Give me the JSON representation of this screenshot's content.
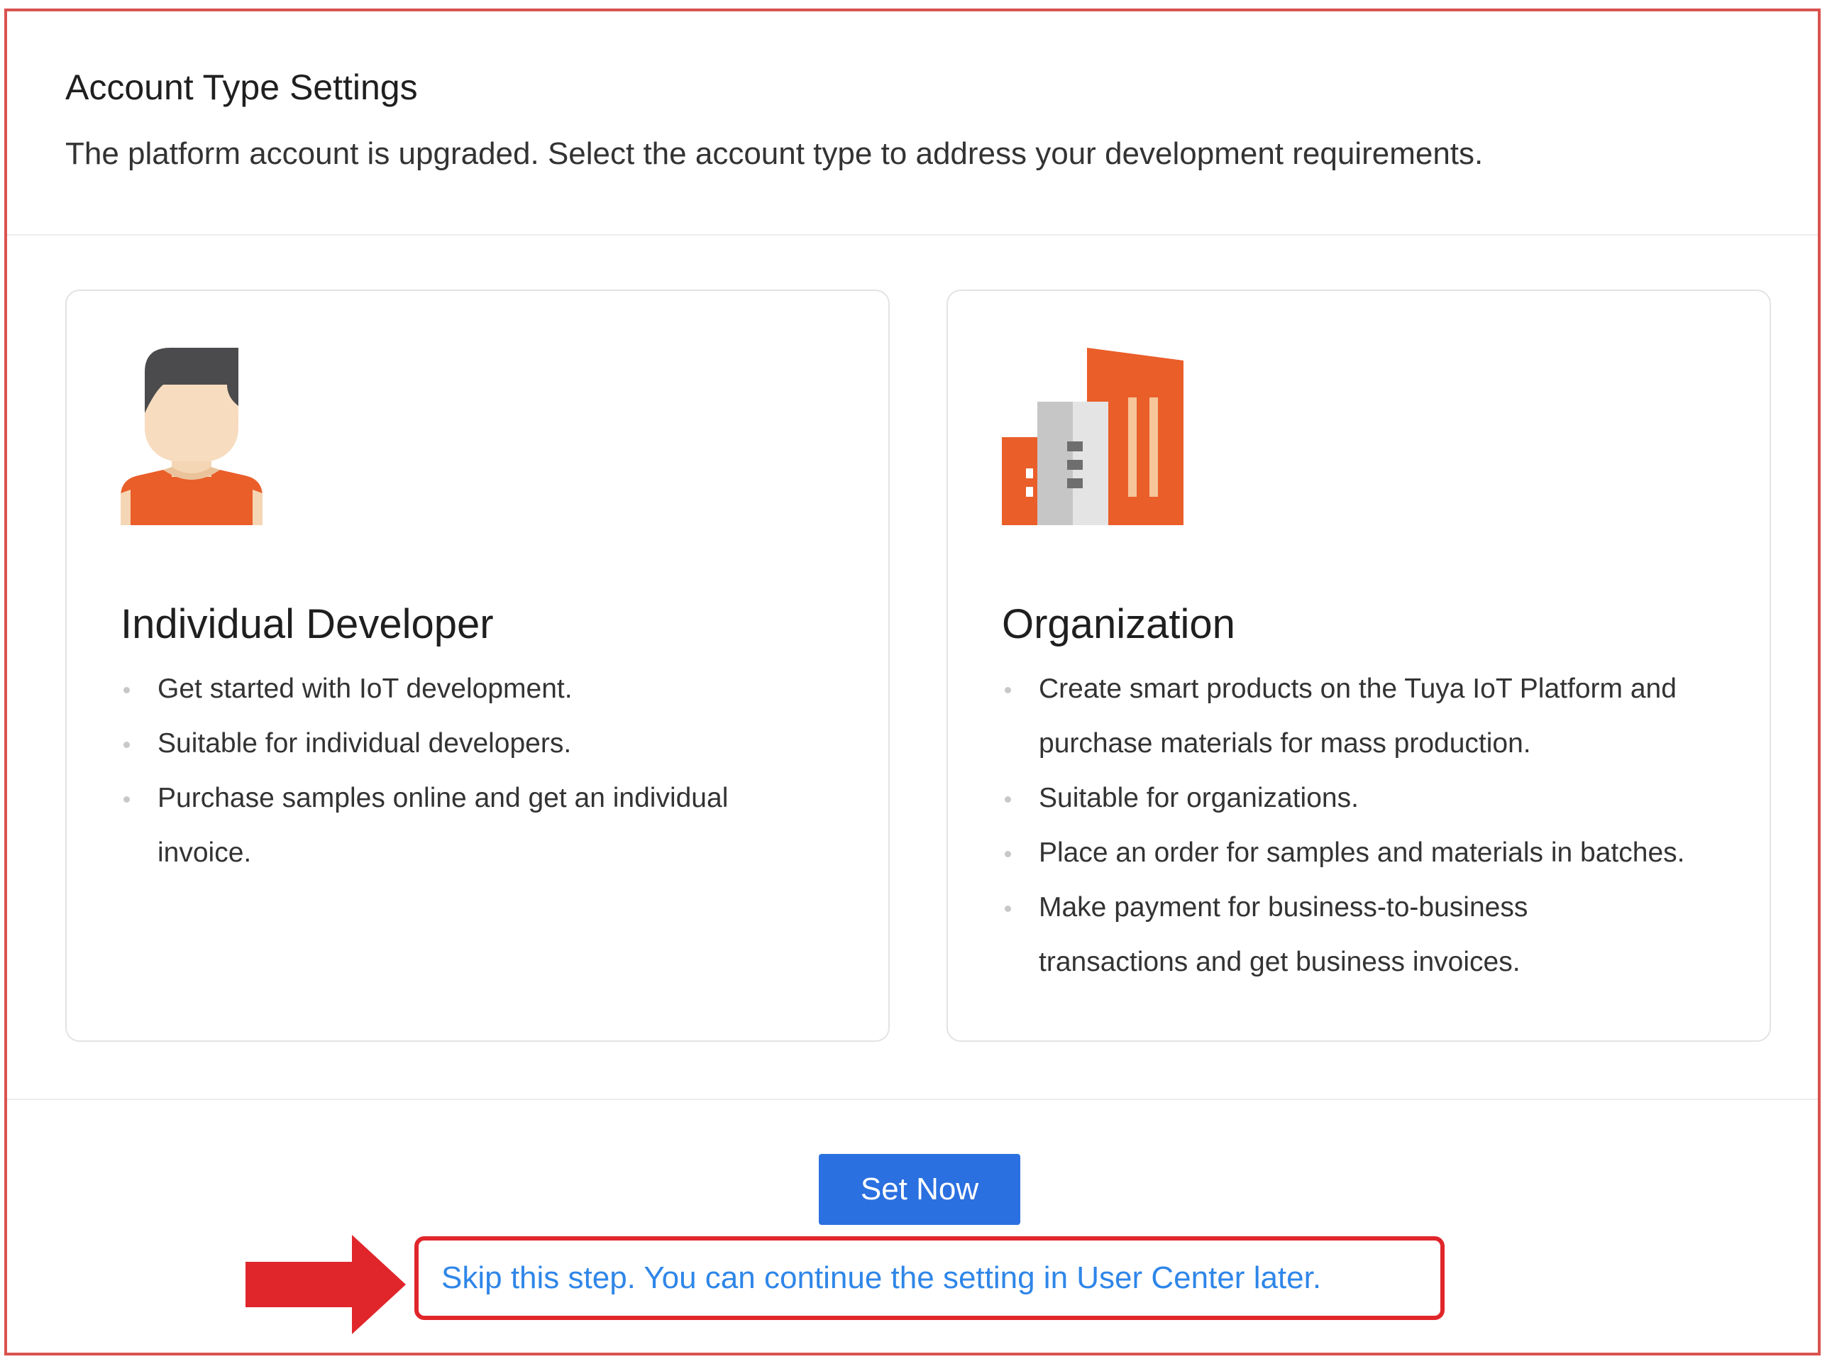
{
  "header": {
    "title": "Account Type Settings",
    "subtitle": "The platform account is upgraded. Select the account type to address your development requirements."
  },
  "cards": [
    {
      "icon": "person-icon",
      "title": "Individual Developer",
      "bullets": [
        "Get started with IoT development.",
        "Suitable for individual developers.",
        "Purchase samples online and get an individual invoice."
      ]
    },
    {
      "icon": "building-icon",
      "title": "Organization",
      "bullets": [
        "Create smart products on the Tuya IoT Platform and purchase materials for mass production.",
        "Suitable for organizations.",
        "Place an order for samples and materials in batches.",
        "Make payment for business-to-business transactions and get business invoices."
      ]
    }
  ],
  "footer": {
    "set_now_label": "Set Now",
    "skip_link_text": "Skip this step. You can continue the setting in User Center later."
  },
  "colors": {
    "primary": "#2a70e0",
    "link": "#2f86e8",
    "highlight": "#e0262b",
    "accent_orange": "#ea5e2a"
  }
}
